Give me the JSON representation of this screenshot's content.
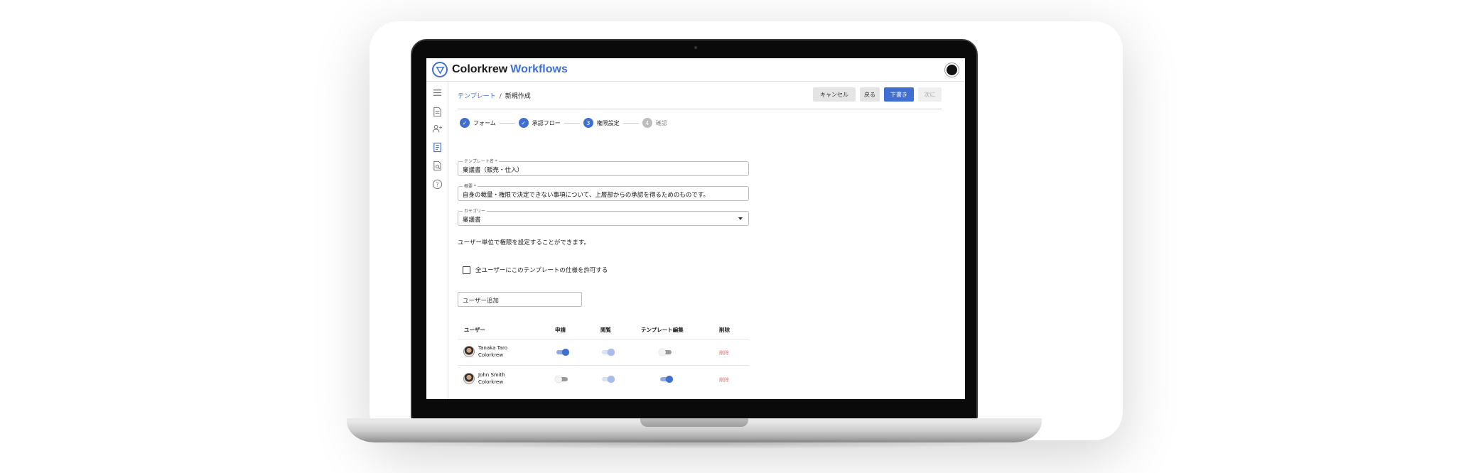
{
  "app": {
    "brand_prefix": "Colorkrew",
    "brand_suffix": "Workflows",
    "accent": "#3e6fd1"
  },
  "breadcrumb": {
    "parent": "テンプレート",
    "separator": "/",
    "current": "新規作成"
  },
  "actions": {
    "cancel": "キャンセル",
    "back": "戻る",
    "draft": "下書き",
    "next": "次に"
  },
  "steps": [
    {
      "number": "",
      "label": "フォーム",
      "state": "done"
    },
    {
      "number": "",
      "label": "承認フロー",
      "state": "done"
    },
    {
      "number": "3",
      "label": "権限設定",
      "state": "current"
    },
    {
      "number": "4",
      "label": "確認",
      "state": "todo"
    }
  ],
  "fields": {
    "template_name": {
      "label": "テンプレート名 *",
      "value": "稟議書（販売・仕入）"
    },
    "summary": {
      "label": "概要 *",
      "value": "自身の裁量・権限で決定できない事項について、上層部からの承認を得るためのものです。"
    },
    "category": {
      "label": "カテゴリー",
      "value": "稟議書"
    }
  },
  "permission_note": "ユーザー単位で権限を設定することができます。",
  "allow_all_checkbox": {
    "label": "全ユーザーにこのテンプレートの仕様を許可する",
    "checked": false
  },
  "user_add": {
    "placeholder": "ユーザー追加"
  },
  "table": {
    "headers": {
      "user": "ユーザー",
      "apply": "申請",
      "view": "閲覧",
      "edit": "テンプレート編集",
      "delete": "削除"
    },
    "rows": [
      {
        "name": "Tanaka Taro",
        "org": "Colorkrew",
        "apply": "on",
        "view": "on-disabled",
        "edit": "off",
        "delete_label": "削除"
      },
      {
        "name": "John Smith",
        "org": "Colorkrew",
        "apply": "off",
        "view": "on-disabled",
        "edit": "on",
        "delete_label": "削除"
      }
    ]
  }
}
